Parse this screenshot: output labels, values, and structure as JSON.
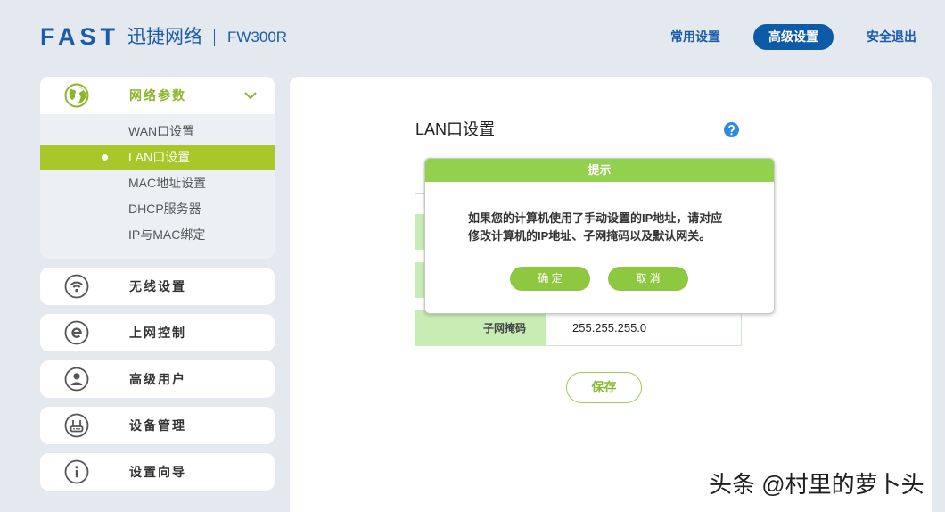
{
  "header": {
    "logo": "FAST",
    "brand_cn": "迅捷网络",
    "model": "FW300R",
    "nav": [
      {
        "label": "常用设置",
        "active": false
      },
      {
        "label": "高级设置",
        "active": true
      },
      {
        "label": "安全退出",
        "active": false
      }
    ]
  },
  "sidebar": {
    "network": {
      "label": "网络参数",
      "icon": "globe-icon",
      "expanded": true,
      "items": [
        {
          "label": "WAN口设置",
          "selected": false
        },
        {
          "label": "LAN口设置",
          "selected": true
        },
        {
          "label": "MAC地址设置",
          "selected": false
        },
        {
          "label": "DHCP服务器",
          "selected": false
        },
        {
          "label": "IP与MAC绑定",
          "selected": false
        }
      ]
    },
    "menus": [
      {
        "label": "无线设置",
        "icon": "wifi-icon"
      },
      {
        "label": "上网控制",
        "icon": "e-icon"
      },
      {
        "label": "高级用户",
        "icon": "user-icon"
      },
      {
        "label": "设备管理",
        "icon": "router-icon"
      },
      {
        "label": "设置向导",
        "icon": "info-icon"
      }
    ]
  },
  "main": {
    "title": "LAN口设置",
    "help_icon": "help-icon",
    "fields": [
      {
        "label": "子网掩码",
        "value": "255.255.255.0"
      }
    ],
    "save_label": "保存"
  },
  "dialog": {
    "title": "提示",
    "message_line1": "如果您的计算机使用了手动设置的IP地址，请对应",
    "message_line2": "修改计算机的IP地址、子网掩码以及默认网关。",
    "confirm_label": "确 定",
    "cancel_label": "取 消"
  },
  "watermark": "头条 @村里的萝卜头",
  "colors": {
    "brand_blue": "#1b5ba8",
    "nav_active_bg": "#0d5aa6",
    "accent_green": "#8cb52b",
    "selected_bg": "#a8c82a",
    "dialog_header": "#91d14e",
    "button_green": "#8ec740",
    "label_bg": "#c8edb4",
    "help_blue": "#2e8ae0",
    "page_bg": "#e4e8ef"
  }
}
